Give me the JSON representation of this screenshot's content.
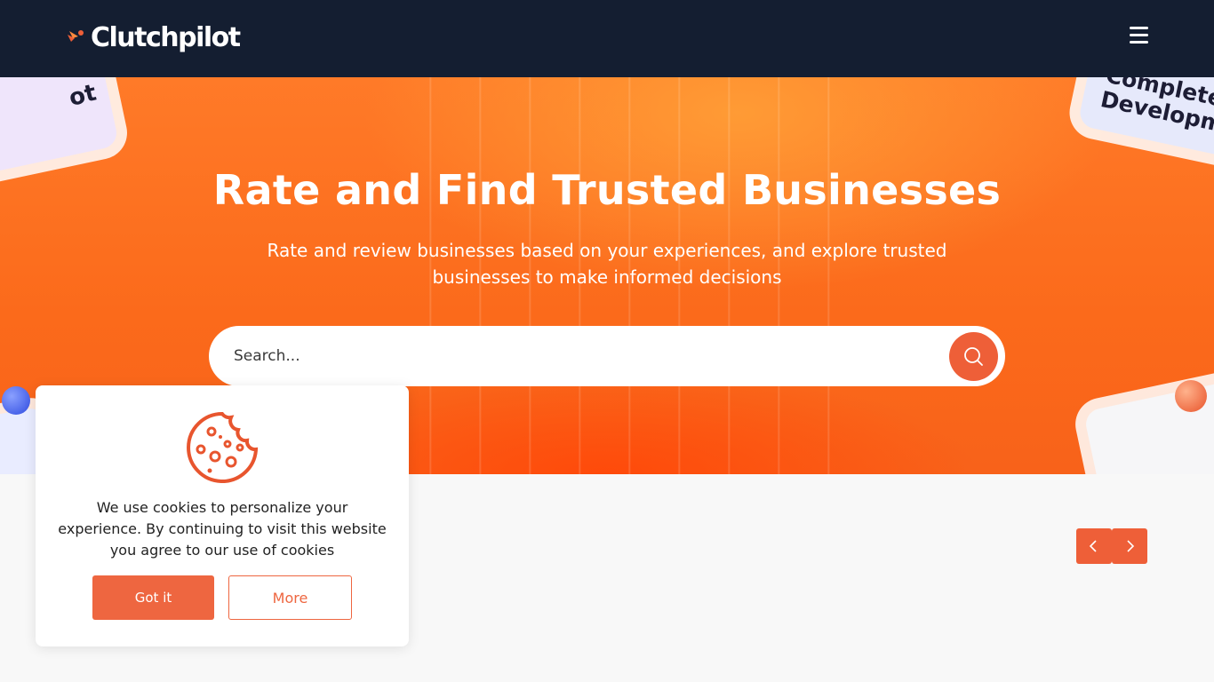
{
  "header": {
    "logo_text": "Clutchpilot",
    "menu_icon": "hamburger-menu-icon"
  },
  "hero": {
    "title": "Rate and Find Trusted Businesses",
    "subtitle": "Rate and review businesses based on your experiences, and explore trusted businesses to make informed decisions",
    "deco_left_text": "ot",
    "deco_right_text": "Complete Developm"
  },
  "search": {
    "placeholder": "Search...",
    "button_icon": "search-icon"
  },
  "carousel": {
    "prev_icon": "chevron-left-icon",
    "next_icon": "chevron-right-icon"
  },
  "cookie_banner": {
    "icon": "cookie-icon",
    "message": "We use cookies to personalize your experience. By continuing to visit this website you agree to our use of cookies",
    "accept_label": "Got it",
    "more_label": "More"
  },
  "colors": {
    "header_bg": "#141e31",
    "accent": "#ee5f38",
    "hero_orange": "#fb6a1b"
  }
}
